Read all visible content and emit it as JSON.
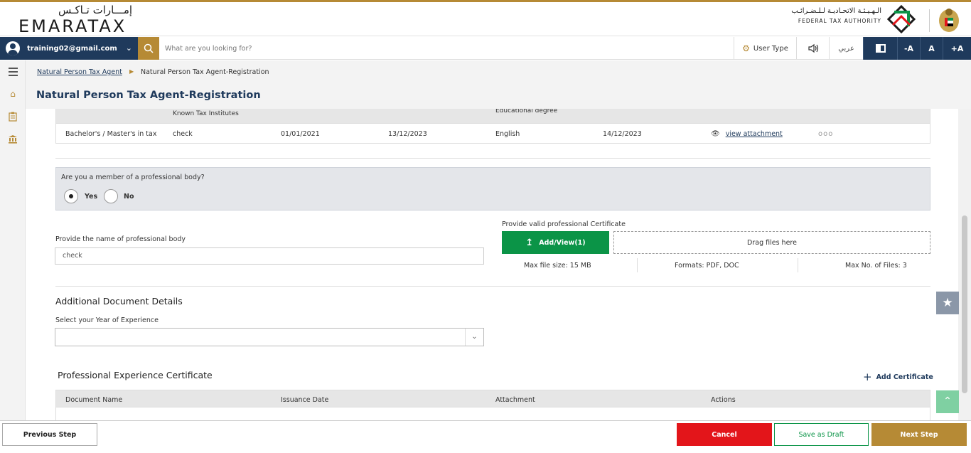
{
  "header": {
    "logo_ar": "إمـــارات تـاكـس",
    "logo_en": "EMARATAX",
    "fta_ar": "الـهـيـئـة الاتحـاديـة لـلـضـرائـب",
    "fta_en": "FEDERAL TAX AUTHORITY"
  },
  "toolbar": {
    "user_email": "training02@gmail.com",
    "search_placeholder": "What are you looking for?",
    "user_type": "User Type",
    "arabic": "عربي",
    "font_minus": "-A",
    "font_normal": "A",
    "font_plus": "+A"
  },
  "breadcrumb": {
    "parent": "Natural Person Tax Agent",
    "current": "Natural Person Tax Agent-Registration"
  },
  "page": {
    "title": "Natural Person Tax Agent-Registration"
  },
  "education_table": {
    "header_fragments": [
      "Known Tax Institutes",
      "Educational degree"
    ],
    "row": {
      "qualification": "Bachelor's / Master's in tax",
      "institute": "check",
      "from_date": "01/01/2021",
      "to_date": "13/12/2023",
      "language": "English",
      "date": "14/12/2023",
      "attachment": "view attachment",
      "actions": "ooo"
    }
  },
  "professional_body": {
    "question": "Are you a member of a professional body?",
    "yes": "Yes",
    "no": "No",
    "selected": "Yes",
    "name_label": "Provide the name of professional body",
    "name_value": "check",
    "cert_label": "Provide valid professional Certificate",
    "upload_label": "Add/View(1)",
    "drag_label": "Drag files here",
    "max_size": "Max file size: 15 MB",
    "formats": "Formats: PDF, DOC",
    "max_files": "Max No. of Files: 3"
  },
  "additional": {
    "title": "Additional Document Details",
    "experience_label": "Select your Year of Experience",
    "experience_value": ""
  },
  "experience_cert": {
    "title": "Professional Experience Certificate",
    "add_label": "Add Certificate",
    "columns": [
      "Document Name",
      "Issuance Date",
      "Attachment",
      "Actions"
    ]
  },
  "footer": {
    "previous": "Previous Step",
    "cancel": "Cancel",
    "draft": "Save as Draft",
    "next": "Next Step"
  },
  "colors": {
    "gold": "#b68a35",
    "navy": "#1f3a5c",
    "green": "#0b9447",
    "red": "#e3151a"
  }
}
